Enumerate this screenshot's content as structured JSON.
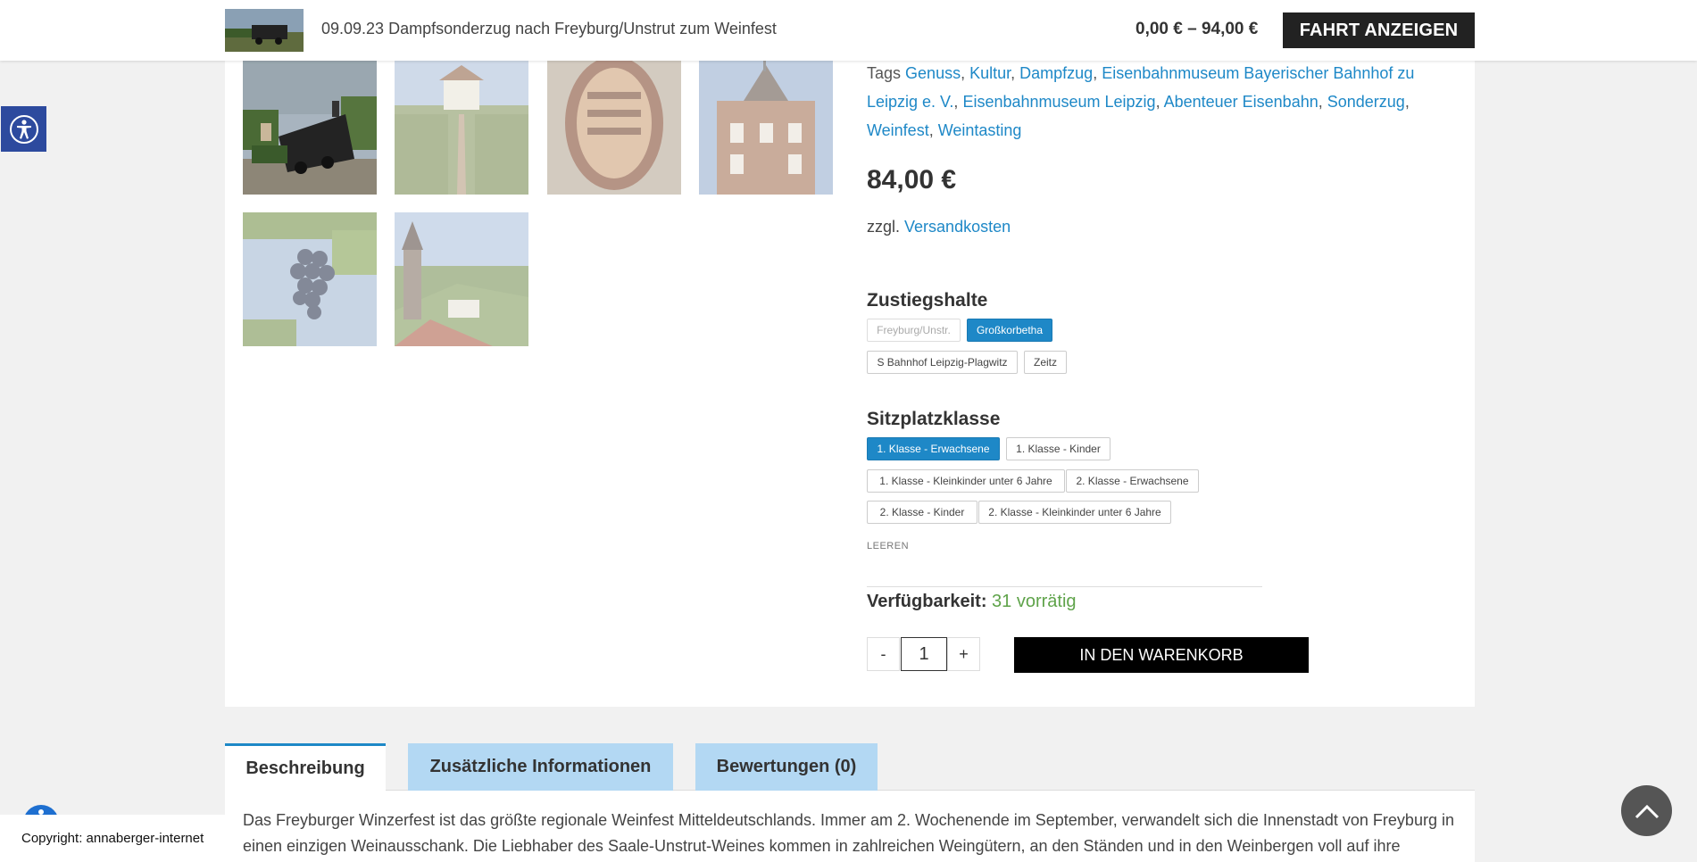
{
  "sticky": {
    "title": "09.09.23 Dampfsonderzug nach Freyburg/Unstrut zum Weinfest",
    "price_range": "0,00 € – 94,00 €",
    "button": "FAHRT ANZEIGEN"
  },
  "gallery": {
    "icons": [
      "steam-train-photo",
      "vineyard-photo",
      "wine-barrel-photo",
      "town-hall-photo",
      "grapes-photo",
      "castle-vineyard-photo"
    ]
  },
  "product": {
    "tags_label": "Tags",
    "tags": [
      "Genuss",
      "Kultur",
      "Dampfzug",
      "Eisenbahnmuseum Bayerischer Bahnhof zu Leipzig e. V.",
      "Eisenbahnmuseum Leipzig",
      "Abenteuer Eisenbahn",
      "Sonderzug",
      "Weinfest",
      "Weintasting"
    ],
    "price": "84,00 €",
    "shipping_prefix": "zzgl.",
    "shipping_link": "Versandkosten"
  },
  "variants": {
    "stops_label": "Zustiegshalte",
    "stops": [
      "Freyburg/Unstr.",
      "Großkorbetha",
      "S Bahnhof Leipzig-Plagwitz",
      "Zeitz"
    ],
    "stops_selected": "Großkorbetha",
    "class_label": "Sitzplatzklasse",
    "classes": [
      "1. Klasse - Erwachsene",
      "1. Klasse - Kinder",
      "1. Klasse - Kleinkinder unter 6 Jahre",
      "2. Klasse - Erwachsene",
      "2. Klasse - Kinder",
      "2. Klasse - Kleinkinder unter 6 Jahre"
    ],
    "class_selected": "1. Klasse - Erwachsene",
    "clear": "LEEREN"
  },
  "stock": {
    "label": "Verfügbarkeit:",
    "value": "31 vorrätig"
  },
  "cart": {
    "minus": "-",
    "plus": "+",
    "quantity": "1",
    "button": "IN DEN WARENKORB"
  },
  "tabs": [
    "Beschreibung",
    "Zusätzliche Informationen",
    "Bewertungen (0)"
  ],
  "description": "Das Freyburger Winzerfest ist das größte regionale Weinfest Mitteldeutschlands. Immer am 2. Wochenende im September, verwandelt sich die Innenstadt von Freyburg in einen einzigen Weinausschank. Die Liebhaber des Saale-Unstrut-Weines kommen in zahlreichen Weingütern, an den Ständen und in den Weinbergen voll auf ihre",
  "copyright": "Copyright: annaberger-internet",
  "colors": {
    "accent": "#1e88c7",
    "tab_inactive": "#b3d8f3",
    "stock_green": "#5fa34a",
    "a11y_blue": "#2d4a9e"
  }
}
